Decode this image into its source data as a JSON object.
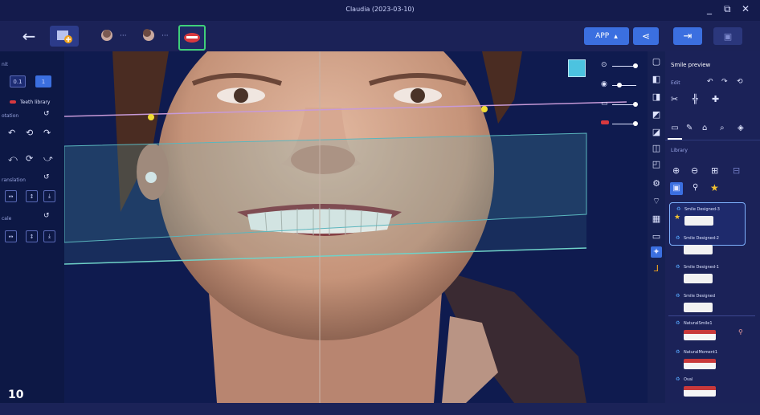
{
  "window": {
    "title": "Claudia (2023-03-10)"
  },
  "toolbar": {
    "app_label": "APP"
  },
  "left_panel": {
    "unit_label": "nit",
    "unit_options": [
      "0.1",
      "1"
    ],
    "library_label": "Teeth library",
    "rotation_label": "otation",
    "translation_label": "ranslation",
    "scale_label": "cale"
  },
  "right_panel": {
    "title": "Smile preview",
    "edit_label": "Edit",
    "library_label": "Library",
    "cards": [
      {
        "name": "Smile Designed-3",
        "selected": true,
        "starred": true,
        "style": "white"
      },
      {
        "name": "Smile Designed-2",
        "selected": false,
        "style": "white"
      },
      {
        "name": "Smile Designed-1",
        "selected": false,
        "style": "white"
      },
      {
        "name": "Smile Designed",
        "selected": false,
        "style": "white"
      },
      {
        "name": "NaturalSmile1",
        "selected": false,
        "style": "red"
      },
      {
        "name": "NaturalMoment1",
        "selected": false,
        "style": "red"
      },
      {
        "name": "Oval",
        "selected": false,
        "style": "red"
      }
    ]
  },
  "figure_label": "10",
  "colors": {
    "accent": "#3b6fe0",
    "toolbar_bg": "#1b2257",
    "panel_bg": "#0d1845",
    "highlight": "#4cc3e0"
  }
}
